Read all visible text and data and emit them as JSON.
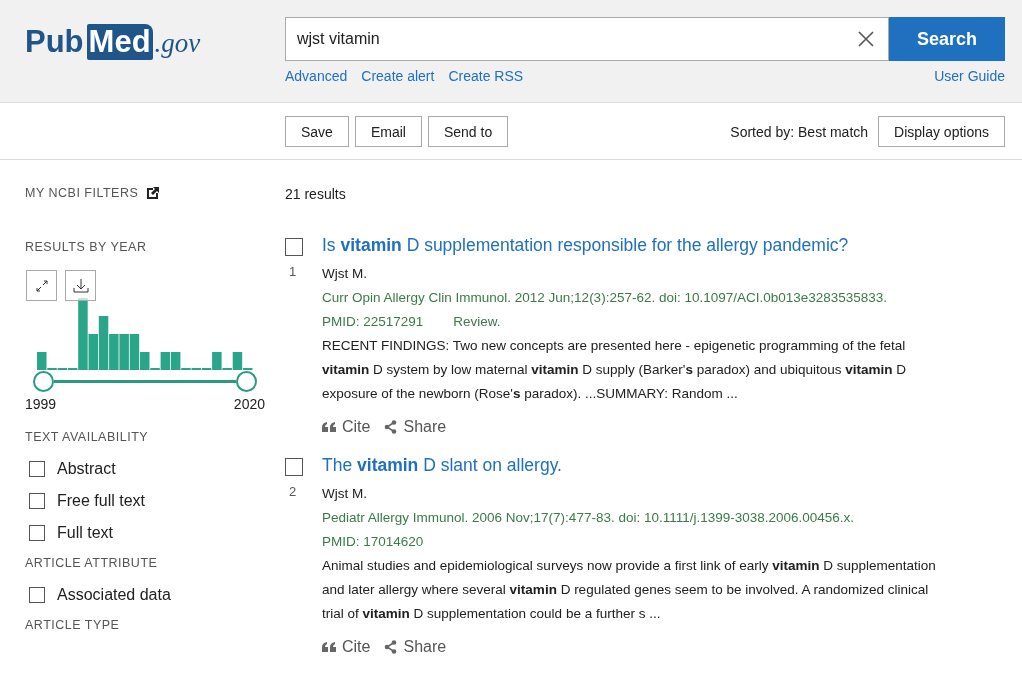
{
  "header": {
    "logo": {
      "parts": [
        "Pub",
        "Med"
      ],
      "suffix": ".gov"
    },
    "search": {
      "value": "wjst vitamin",
      "button": "Search"
    },
    "links": [
      "Advanced",
      "Create alert",
      "Create RSS"
    ],
    "user_guide": "User Guide"
  },
  "toolbar": {
    "buttons": [
      "Save",
      "Email",
      "Send to"
    ],
    "sort_label": "Sorted by: Best match",
    "display_button": "Display options"
  },
  "sidebar": {
    "my_filters": "MY NCBI FILTERS",
    "results_by_year": {
      "title": "RESULTS BY YEAR",
      "start_year": "1999",
      "end_year": "2020"
    },
    "groups": [
      {
        "title": "TEXT AVAILABILITY",
        "options": [
          {
            "label": "Abstract",
            "checked": false
          },
          {
            "label": "Free full text",
            "checked": false
          },
          {
            "label": "Full text",
            "checked": false
          }
        ]
      },
      {
        "title": "ARTICLE ATTRIBUTE",
        "options": [
          {
            "label": "Associated data",
            "checked": false
          }
        ]
      },
      {
        "title": "ARTICLE TYPE"
      }
    ]
  },
  "results_count": "21 results",
  "results": [
    {
      "number": "1",
      "selected": false,
      "title": "Is **vitamin** D supplementation responsible for the allergy pandemic?",
      "authors": "Wjst M.",
      "citation": "Curr Opin Allergy Clin Immunol. 2012 Jun;12(3):257-62. doi: 10.1097/ACI.0b013e3283535833.",
      "pmid": "PMID: 22517291",
      "type": "Review.",
      "snippet": "RECENT FINDINGS: Two new concepts are presented here - epigenetic programming of the fetal **vitamin** D system by low maternal **vitamin** D supply (Barker'**s** paradox) and ubiquitous **vitamin** D exposure of the newborn (Rose'**s** paradox). ...SUMMARY: Random ...",
      "cite": "Cite",
      "share": "Share"
    },
    {
      "number": "2",
      "selected": false,
      "title": "The **vitamin** D slant on allergy.",
      "authors": "Wjst M.",
      "citation": "Pediatr Allergy Immunol. 2006 Nov;17(7):477-83. doi: 10.1111/j.1399-3038.2006.00456.x.",
      "pmid": "PMID: 17014620",
      "snippet": "Animal studies and epidemiological surveys now provide a first link of early **vitamin** D supplementation and later allergy where several **vitamin** D regulated genes seem to be involved. A randomized clinical trial of **vitamin** D supplementation could be a further s ...",
      "cite": "Cite",
      "share": "Share"
    }
  ]
}
